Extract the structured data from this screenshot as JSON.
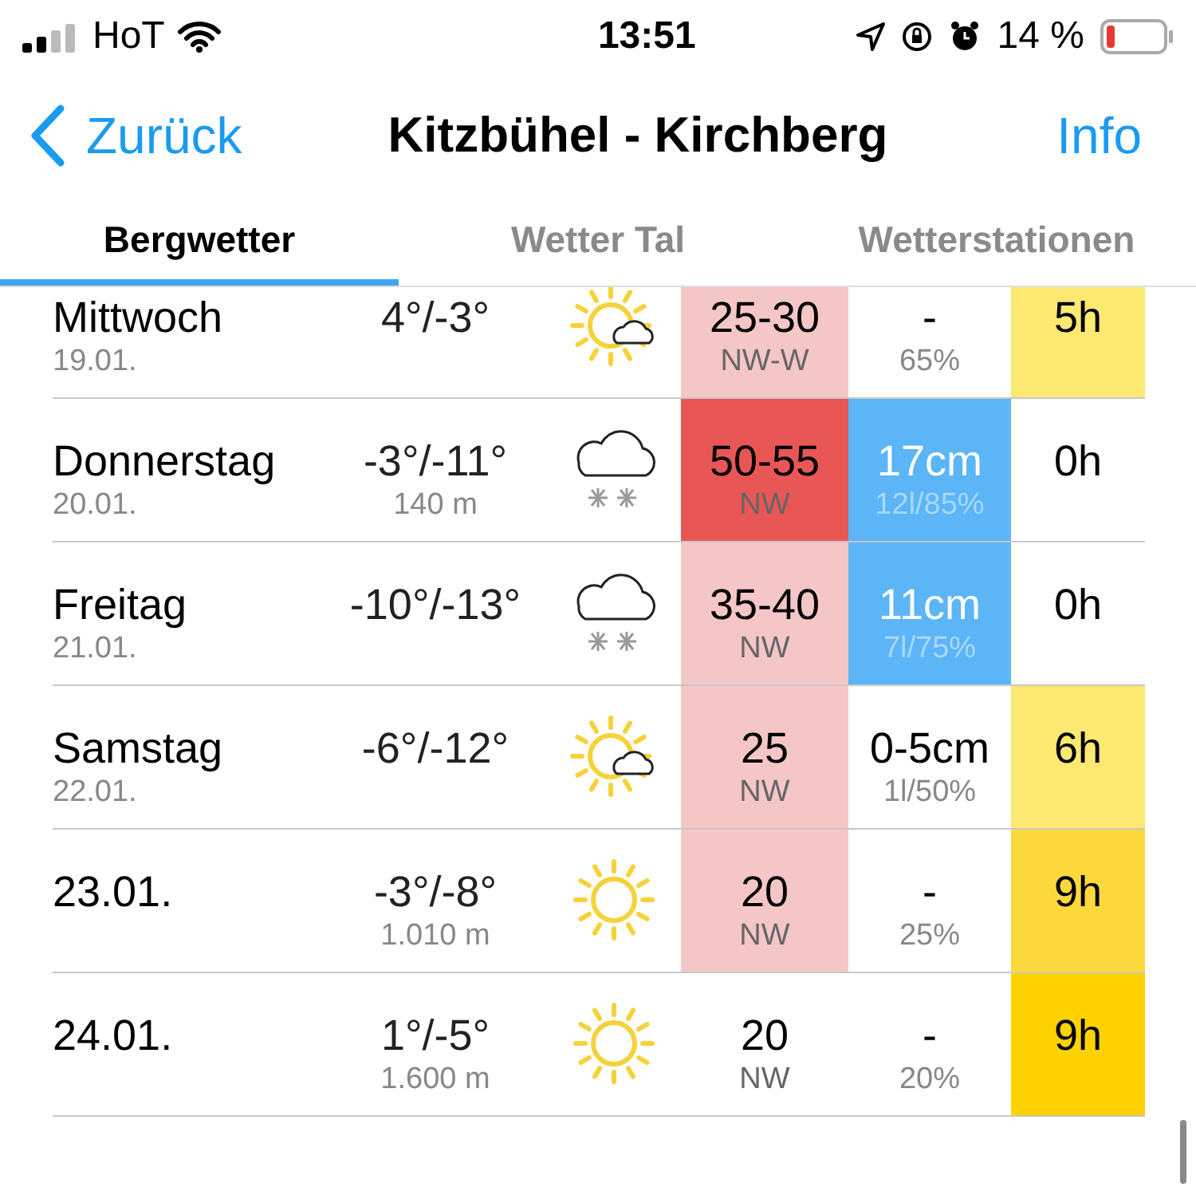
{
  "status_bar": {
    "carrier": "HoT",
    "time": "13:51",
    "battery_text": "14 %"
  },
  "nav": {
    "back": "Zurück",
    "title": "Kitzbühel - Kirchberg",
    "info": "Info"
  },
  "tabs": [
    {
      "label": "Bergwetter",
      "selected": true
    },
    {
      "label": "Wetter Tal",
      "selected": false
    },
    {
      "label": "Wetterstationen",
      "selected": false
    }
  ],
  "rows": [
    {
      "day": "Mittwoch",
      "date": "19.01.",
      "temp": "4°/-3°",
      "weather": {
        "kind": "sun-cloud"
      },
      "wind": {
        "speed": "25-30",
        "direction": "NW-W",
        "color": "#f5c6c6"
      },
      "precipitation": {
        "amount": "-",
        "detail": "65%"
      },
      "sunshine": {
        "hours": "5h",
        "color": "#fde872"
      }
    },
    {
      "day": "Donnerstag",
      "date": "20.01.",
      "temp": "-3°/-11°",
      "snowline": "140 m",
      "weather": {
        "kind": "snow-cloud"
      },
      "wind": {
        "speed": "50-55",
        "direction": "NW",
        "color": "#e85656"
      },
      "precipitation": {
        "amount": "17cm",
        "detail": "12l/85%",
        "color": "#5bb5f7"
      },
      "sunshine": {
        "hours": "0h"
      }
    },
    {
      "day": "Freitag",
      "date": "21.01.",
      "temp": "-10°/-13°",
      "weather": {
        "kind": "snow-cloud"
      },
      "wind": {
        "speed": "35-40",
        "direction": "NW",
        "color": "#f5c6c6"
      },
      "precipitation": {
        "amount": "11cm",
        "detail": "7l/75%",
        "color": "#5bb5f7"
      },
      "sunshine": {
        "hours": "0h"
      }
    },
    {
      "day": "Samstag",
      "date": "22.01.",
      "temp": "-6°/-12°",
      "weather": {
        "kind": "sun-cloud"
      },
      "wind": {
        "speed": "25",
        "direction": "NW",
        "color": "#f5c6c6"
      },
      "precipitation": {
        "amount": "0-5cm",
        "detail": "1l/50%"
      },
      "sunshine": {
        "hours": "6h",
        "color": "#fde872"
      }
    },
    {
      "date": "23.01.",
      "temp": "-3°/-8°",
      "snowline": "1.010 m",
      "weather": {
        "kind": "sun"
      },
      "wind": {
        "speed": "20",
        "direction": "NW",
        "color": "#f5c6c6"
      },
      "precipitation": {
        "amount": "-",
        "detail": "25%"
      },
      "sunshine": {
        "hours": "9h",
        "color": "#fdd83d"
      }
    },
    {
      "date": "24.01.",
      "temp": "1°/-5°",
      "snowline": "1.600 m",
      "weather": {
        "kind": "sun"
      },
      "wind": {
        "speed": "20",
        "direction": "NW"
      },
      "precipitation": {
        "amount": "-",
        "detail": "20%"
      },
      "sunshine": {
        "hours": "9h",
        "color": "#fdd200"
      }
    }
  ]
}
